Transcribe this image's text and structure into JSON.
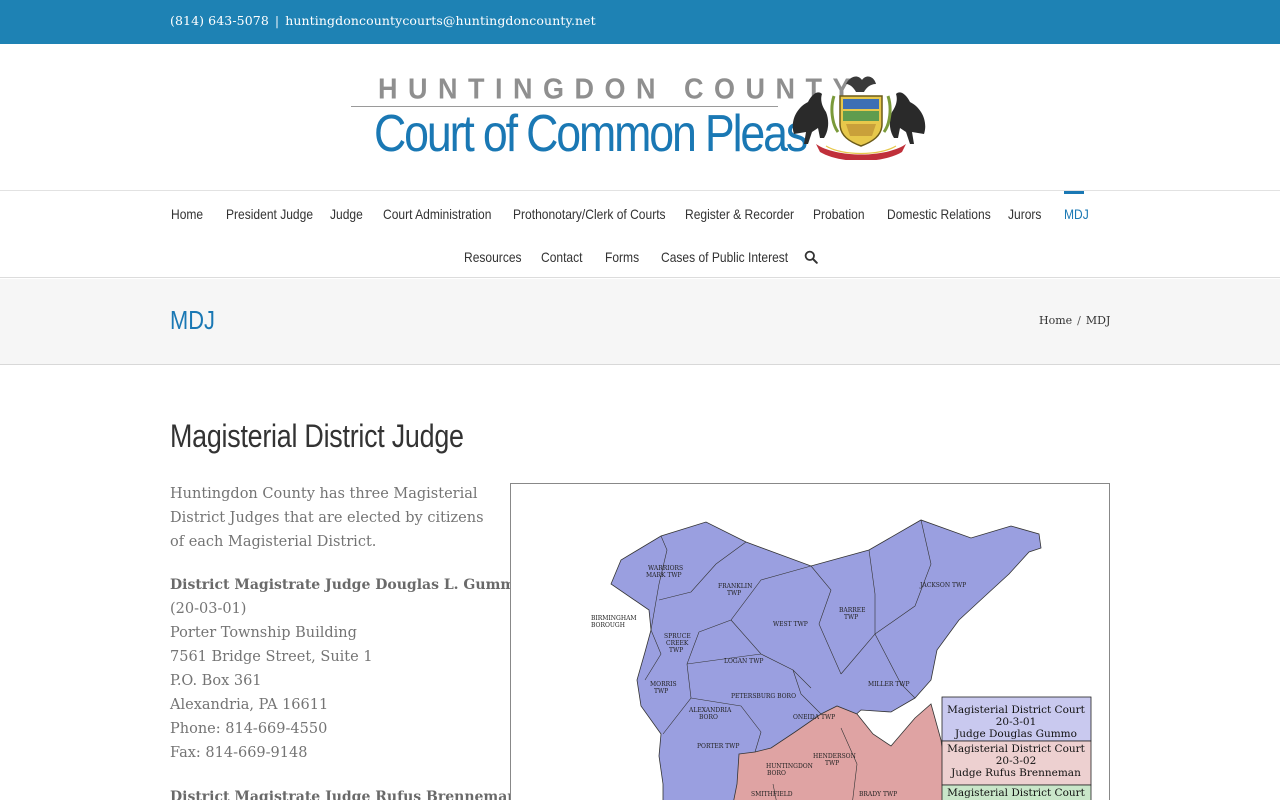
{
  "topbar": {
    "phone": "(814) 643-5078",
    "separator": "|",
    "email": "huntingdoncountycourts@huntingdoncounty.net"
  },
  "logo": {
    "county": "HUNTINGDON COUNTY",
    "court": "Court of Common Pleas",
    "seal_icon": "pennsylvania-coat-of-arms"
  },
  "nav": {
    "row1": [
      "Home",
      "President Judge",
      "Judge",
      "Court Administration",
      "Prothonotary/Clerk of Courts",
      "Register & Recorder",
      "Probation",
      "Domestic Relations",
      "Jurors",
      "MDJ"
    ],
    "row2": [
      "Resources",
      "Contact",
      "Forms",
      "Cases of Public Interest"
    ],
    "active": "MDJ",
    "search_icon": "search-icon"
  },
  "titlebar": {
    "title": "MDJ",
    "breadcrumb_home": "Home",
    "breadcrumb_sep": "/",
    "breadcrumb_current": "MDJ"
  },
  "content": {
    "heading": "Magisterial District Judge",
    "intro": "Huntingdon County has three Magisterial District Judges that are elected by citizens of each Magisterial District.",
    "judge1": {
      "name": "District Magistrate Judge Douglas L. Gummo",
      "code": "(20-03-01)",
      "building": "Porter Township Building",
      "street": "7561 Bridge Street, Suite 1",
      "po": "P.O. Box 361",
      "city": "Alexandria, PA 16611",
      "phone": "Phone: 814-669-4550",
      "fax": "Fax: 814-669-9148"
    },
    "judge2": {
      "name": "District Magistrate Judge Rufus Brenneman"
    }
  },
  "map": {
    "labels": {
      "warriors": [
        "WARRIORS",
        "MARK TWP"
      ],
      "franklin": [
        "FRANKLIN",
        "TWP"
      ],
      "birmingham": [
        "BIRMINGHAM",
        "BOROUGH"
      ],
      "spruce": [
        "SPRUCE",
        "CREEK",
        "TWP"
      ],
      "west": "WEST TWP",
      "barree": [
        "BARREE",
        "TWP"
      ],
      "jackson": "JACKSON TWP",
      "logan": "LOGAN TWP",
      "petersburg": [
        "PETERSBURG BORO"
      ],
      "morris": [
        "MORRIS",
        "TWP"
      ],
      "alexandria": [
        "ALEXANDRIA",
        "BORO"
      ],
      "miller": "MILLER TWP",
      "oneida": "ONEIDA TWP",
      "porter": "PORTER TWP",
      "henderson": [
        "HENDERSON",
        "TWP"
      ],
      "huntingdon": [
        "HUNTINGDON",
        "BORO"
      ],
      "smithfield": "SMITHFIELD",
      "brady": "BRADY TWP"
    },
    "legend": [
      {
        "court": "Magisterial District Court",
        "code": "20-3-01",
        "judge": "Judge Douglas Gummo",
        "color": "#c9c9ef"
      },
      {
        "court": "Magisterial District Court",
        "code": "20-3-02",
        "judge": "Judge Rufus Brenneman",
        "color": "#edd0d0"
      },
      {
        "court": "Magisterial District Court",
        "code": "",
        "judge": "",
        "color": "#c9e6c9"
      }
    ],
    "colors": {
      "district1": "#9a9fe0",
      "district2": "#dfa3a3",
      "district3": "#a9d3a9"
    }
  }
}
